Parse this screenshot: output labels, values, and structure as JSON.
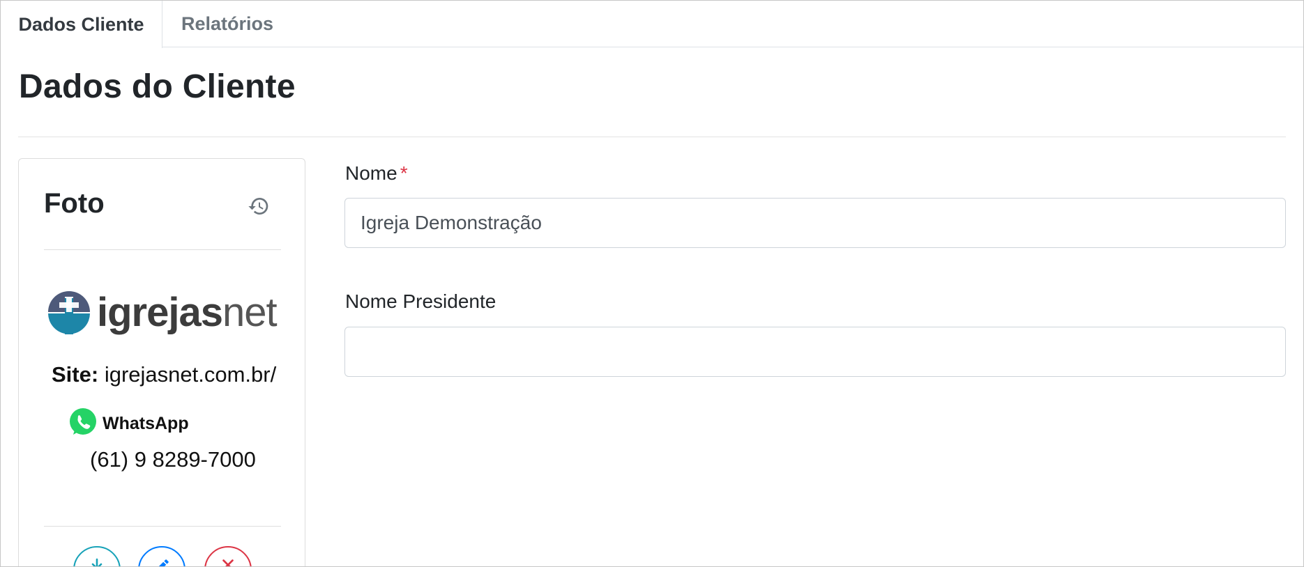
{
  "tabs": [
    {
      "label": "Dados Cliente",
      "active": true
    },
    {
      "label": "Relatórios",
      "active": false
    }
  ],
  "page_title": "Dados do Cliente",
  "photo_card": {
    "title": "Foto",
    "history_icon": "history-icon",
    "image": {
      "logo_text_bold": "igrejas",
      "logo_text_light": "net",
      "site_label": "Site:",
      "site_value": "igrejasnet.com.br/",
      "whatsapp_label": "WhatsApp",
      "phone": "(61) 9 8289-7000"
    },
    "actions": [
      {
        "name": "download",
        "icon": "download-icon",
        "color": "#17a2b8"
      },
      {
        "name": "edit",
        "icon": "pencil-icon",
        "color": "#007bff"
      },
      {
        "name": "remove",
        "icon": "close-icon",
        "color": "#dc3545"
      }
    ]
  },
  "form": {
    "nome": {
      "label": "Nome",
      "required_marker": "*",
      "value": "Igreja Demonstração"
    },
    "nome_presidente": {
      "label": "Nome Presidente",
      "value": ""
    }
  },
  "colors": {
    "required": "#dc3545",
    "info": "#17a2b8",
    "primary": "#007bff",
    "danger": "#dc3545",
    "logo_blue": "#1d86a8",
    "logo_slate": "#4e5a7a",
    "whatsapp_green": "#25d366"
  }
}
